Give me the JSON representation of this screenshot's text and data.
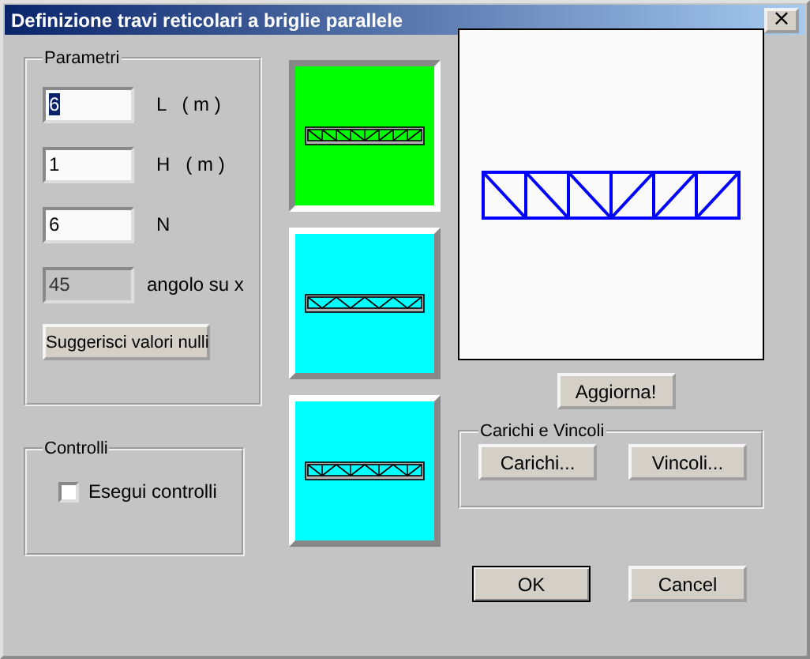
{
  "window": {
    "title": "Definizione travi reticolari a briglie parallele",
    "close": "×"
  },
  "parameters": {
    "label": "Parametri",
    "fields": [
      {
        "value": "6",
        "unit": "L   ( m )",
        "disabled": false,
        "text_selected": true
      },
      {
        "value": "1",
        "unit": "H   ( m )",
        "disabled": false,
        "text_selected": false
      },
      {
        "value": "6",
        "unit": "N",
        "disabled": false,
        "text_selected": false
      },
      {
        "value": "45",
        "unit": "angolo su x",
        "disabled": true,
        "text_selected": false
      }
    ],
    "button": "Suggerisci valori nulli"
  },
  "checks": {
    "label": "Controlli",
    "checkbox": {
      "label": "Esegui controlli",
      "checked": false
    }
  },
  "truss_types": [
    {
      "kind": "pratt",
      "selected": true
    },
    {
      "kind": "warren",
      "selected": false
    },
    {
      "kind": "warren-verticals",
      "selected": false
    }
  ],
  "update_button": "Aggiorna!",
  "loads": {
    "label": "Carichi e Vincoli",
    "buttons": [
      "Carichi...",
      "Vincoli..."
    ]
  },
  "buttons": [
    {
      "label": "OK",
      "default": true
    },
    {
      "label": "Cancel",
      "default": false
    }
  ]
}
